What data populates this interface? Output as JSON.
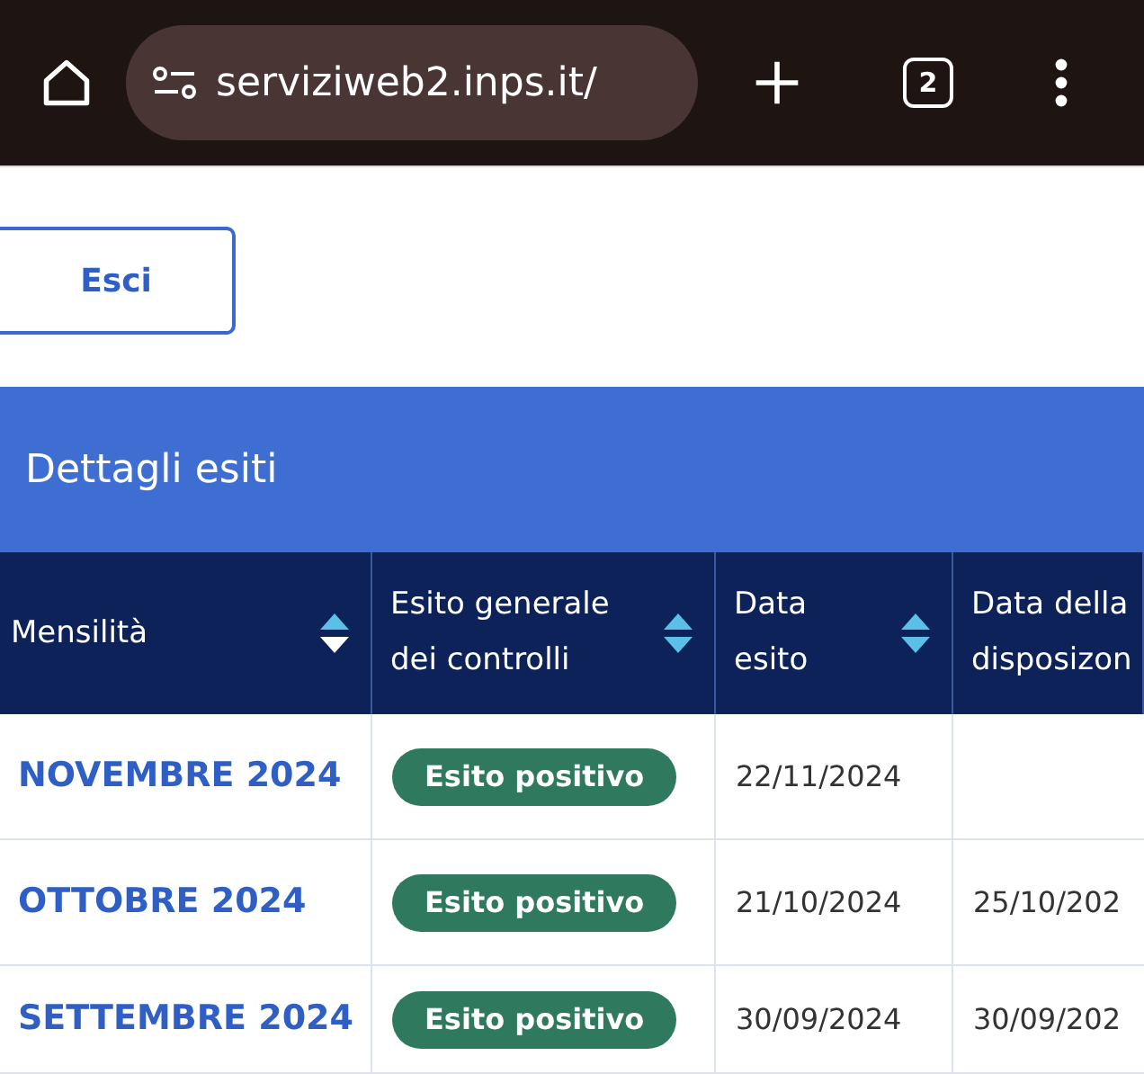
{
  "browser": {
    "url": "serviziweb2.inps.it/",
    "tab_count": "2"
  },
  "exit_button": "Esci",
  "panel_title": "Dettagli esiti",
  "table": {
    "columns": [
      {
        "lines": [
          "Mensilità"
        ],
        "sortable": true,
        "sorted": true
      },
      {
        "lines": [
          "Esito generale",
          "dei controlli"
        ],
        "sortable": true,
        "sorted": false
      },
      {
        "lines": [
          "Data",
          "esito"
        ],
        "sortable": true,
        "sorted": false
      },
      {
        "lines": [
          "Data della",
          "disposizon"
        ],
        "sortable": false
      }
    ],
    "rows": [
      {
        "month": "NOVEMBRE 2024",
        "outcome": "Esito positivo",
        "date": "22/11/2024"
      },
      {
        "month": "OTTOBRE 2024",
        "outcome": "Esito positivo",
        "date": "21/10/2024",
        "disposition_date": "25/10/202"
      },
      {
        "month": "SETTEMBRE 2024",
        "outcome": "Esito positivo",
        "date": "30/09/2024",
        "disposition_date": "30/09/202"
      }
    ]
  }
}
